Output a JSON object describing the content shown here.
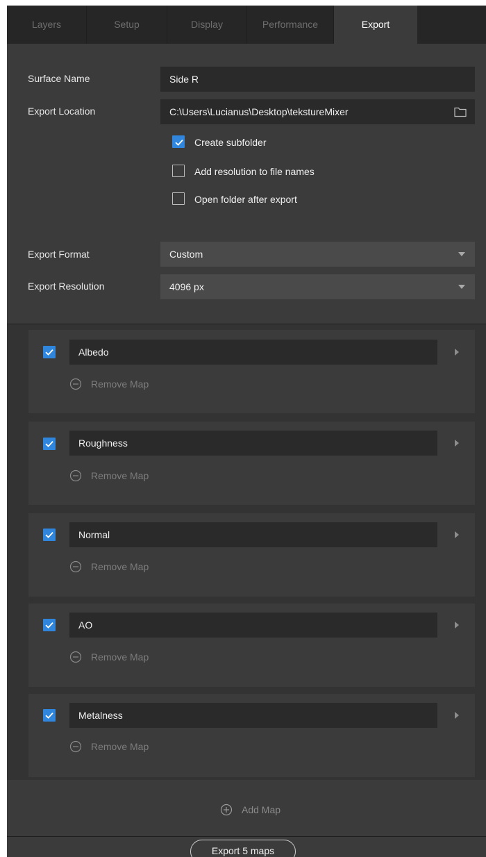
{
  "tabs": [
    {
      "label": "Layers",
      "active": false
    },
    {
      "label": "Setup",
      "active": false
    },
    {
      "label": "Display",
      "active": false
    },
    {
      "label": "Performance",
      "active": false
    },
    {
      "label": "Export",
      "active": true
    }
  ],
  "settings": {
    "surface_name_label": "Surface Name",
    "surface_name_value": "Side R",
    "export_location_label": "Export Location",
    "export_location_value": "C:\\Users\\Lucianus\\Desktop\\tekstureMixer",
    "options": [
      {
        "label": "Create subfolder",
        "checked": true
      },
      {
        "label": "Add resolution to file names",
        "checked": false
      },
      {
        "label": "Open folder after export",
        "checked": false
      }
    ],
    "export_format_label": "Export Format",
    "export_format_value": "Custom",
    "export_resolution_label": "Export Resolution",
    "export_resolution_value": "4096 px"
  },
  "maps": [
    {
      "name": "Albedo",
      "checked": true,
      "remove_label": "Remove Map"
    },
    {
      "name": "Roughness",
      "checked": true,
      "remove_label": "Remove Map"
    },
    {
      "name": "Normal",
      "checked": true,
      "remove_label": "Remove Map"
    },
    {
      "name": "AO",
      "checked": true,
      "remove_label": "Remove Map"
    },
    {
      "name": "Metalness",
      "checked": true,
      "remove_label": "Remove Map"
    }
  ],
  "add_map_label": "Add Map",
  "export_button_label": "Export 5 maps",
  "colors": {
    "accent": "#2f86dc",
    "panel_bg": "#3b3b3b",
    "field_bg": "#2a2a2a",
    "tabbar_bg": "#262626"
  }
}
